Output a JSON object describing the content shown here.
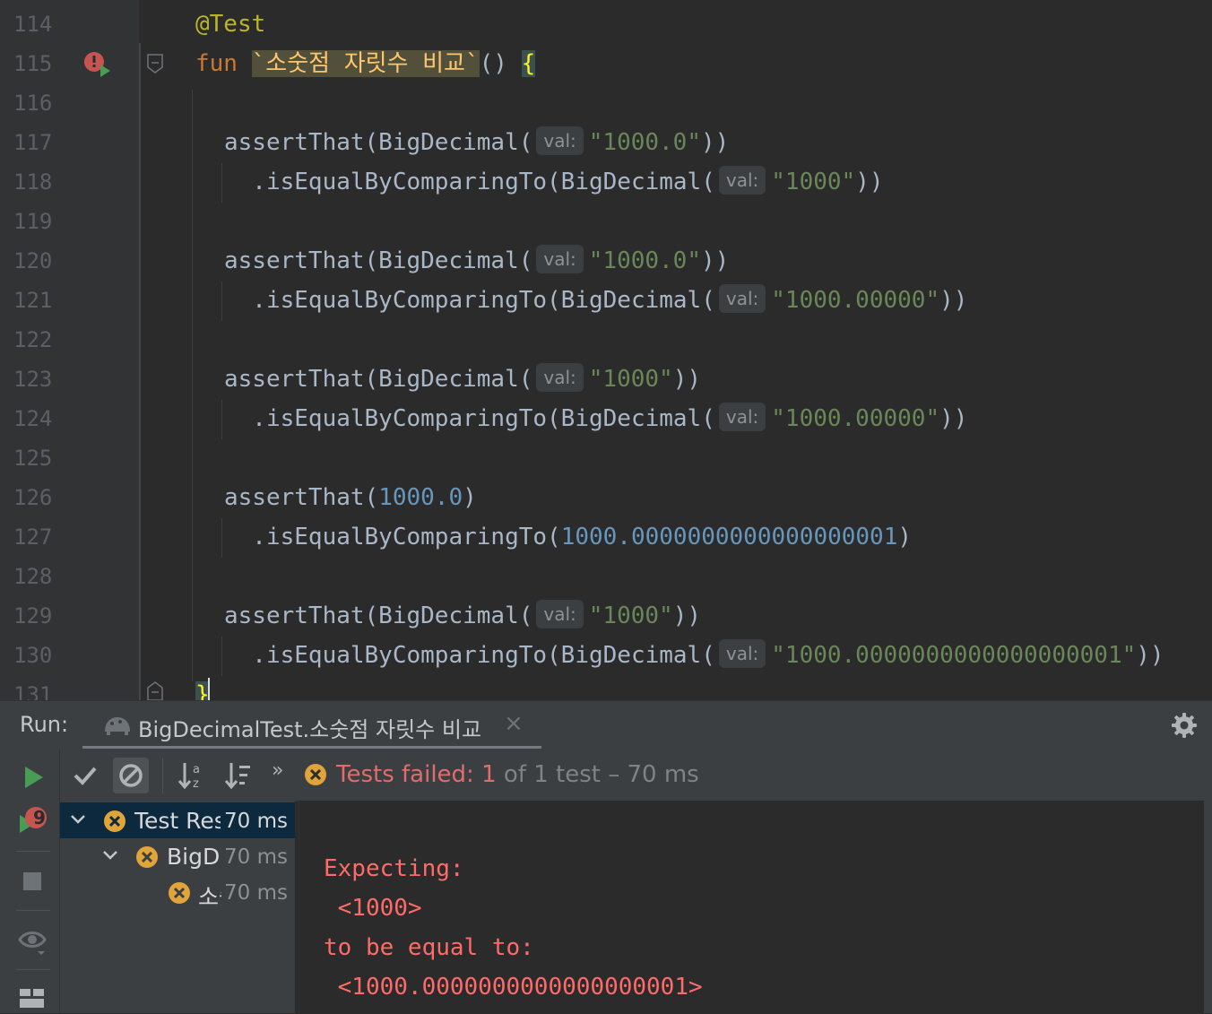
{
  "editor": {
    "line_numbers": [
      "114",
      "115",
      "116",
      "117",
      "118",
      "119",
      "120",
      "121",
      "122",
      "123",
      "124",
      "125",
      "126",
      "127",
      "128",
      "129",
      "130",
      "131"
    ],
    "hint_label": "val:",
    "lines": [
      {
        "n": "114",
        "tokens": [
          {
            "c": "ann",
            "t": "@Test"
          }
        ]
      },
      {
        "n": "115",
        "tokens": [
          {
            "c": "kw",
            "t": "fun"
          },
          {
            "c": "plain",
            "t": " "
          },
          {
            "c": "fname",
            "t": "`소숫점 자릿수 비교`"
          },
          {
            "c": "plain",
            "t": "() "
          },
          {
            "c": "brace-hl",
            "t": "{"
          }
        ]
      },
      {
        "n": "116",
        "tokens": []
      },
      {
        "n": "117",
        "tokens": [
          {
            "c": "plain",
            "t": "assertThat(BigDecimal("
          },
          {
            "c": "hint",
            "t": "val:"
          },
          {
            "c": "str",
            "t": "\"1000.0\""
          },
          {
            "c": "plain",
            "t": "))"
          }
        ]
      },
      {
        "n": "118",
        "tokens": [
          {
            "c": "plain",
            "t": "  .isEqualByComparingTo(BigDecimal("
          },
          {
            "c": "hint",
            "t": "val:"
          },
          {
            "c": "str",
            "t": "\"1000\""
          },
          {
            "c": "plain",
            "t": "))"
          }
        ]
      },
      {
        "n": "119",
        "tokens": []
      },
      {
        "n": "120",
        "tokens": [
          {
            "c": "plain",
            "t": "assertThat(BigDecimal("
          },
          {
            "c": "hint",
            "t": "val:"
          },
          {
            "c": "str",
            "t": "\"1000.0\""
          },
          {
            "c": "plain",
            "t": "))"
          }
        ]
      },
      {
        "n": "121",
        "tokens": [
          {
            "c": "plain",
            "t": "  .isEqualByComparingTo(BigDecimal("
          },
          {
            "c": "hint",
            "t": "val:"
          },
          {
            "c": "str",
            "t": "\"1000.00000\""
          },
          {
            "c": "plain",
            "t": "))"
          }
        ]
      },
      {
        "n": "122",
        "tokens": []
      },
      {
        "n": "123",
        "tokens": [
          {
            "c": "plain",
            "t": "assertThat(BigDecimal("
          },
          {
            "c": "hint",
            "t": "val:"
          },
          {
            "c": "str",
            "t": "\"1000\""
          },
          {
            "c": "plain",
            "t": "))"
          }
        ]
      },
      {
        "n": "124",
        "tokens": [
          {
            "c": "plain",
            "t": "  .isEqualByComparingTo(BigDecimal("
          },
          {
            "c": "hint",
            "t": "val:"
          },
          {
            "c": "str",
            "t": "\"1000.00000\""
          },
          {
            "c": "plain",
            "t": "))"
          }
        ]
      },
      {
        "n": "125",
        "tokens": []
      },
      {
        "n": "126",
        "tokens": [
          {
            "c": "plain",
            "t": "assertThat("
          },
          {
            "c": "num",
            "t": "1000.0"
          },
          {
            "c": "plain",
            "t": ")"
          }
        ]
      },
      {
        "n": "127",
        "tokens": [
          {
            "c": "plain",
            "t": "  .isEqualByComparingTo("
          },
          {
            "c": "num",
            "t": "1000.0000000000000000001"
          },
          {
            "c": "plain",
            "t": ")"
          }
        ]
      },
      {
        "n": "128",
        "tokens": []
      },
      {
        "n": "129",
        "tokens": [
          {
            "c": "plain",
            "t": "assertThat(BigDecimal("
          },
          {
            "c": "hint",
            "t": "val:"
          },
          {
            "c": "str",
            "t": "\"1000\""
          },
          {
            "c": "plain",
            "t": "))"
          }
        ]
      },
      {
        "n": "130",
        "tokens": [
          {
            "c": "plain",
            "t": "  .isEqualByComparingTo(BigDecimal("
          },
          {
            "c": "hint",
            "t": "val:"
          },
          {
            "c": "str",
            "t": "\"1000.0000000000000000001\""
          },
          {
            "c": "plain",
            "t": "))"
          }
        ]
      },
      {
        "n": "131",
        "tokens": [
          {
            "c": "brace-hl",
            "t": "}"
          }
        ]
      }
    ]
  },
  "run_panel": {
    "label": "Run:",
    "tab_title": "BigDecimalTest.소숫점 자릿수 비교",
    "status_failed": "Tests failed: 1",
    "status_rest": " of 1 test – 70 ms",
    "rerun_badge": "9",
    "tree": [
      {
        "label": "Test Results",
        "time": "70 ms",
        "level": 0,
        "selected": true,
        "expanded": true
      },
      {
        "label": "BigDecimalTest",
        "time": "70 ms",
        "level": 1,
        "selected": false,
        "expanded": true
      },
      {
        "label": "소숫점 자릿수 비교",
        "time": "70 ms",
        "level": 2,
        "selected": false,
        "expanded": false
      }
    ],
    "console_lines": [
      "Expecting:",
      " <1000>",
      "to be equal to:",
      " <1000.0000000000000000001>"
    ]
  },
  "colors": {
    "background": "#2b2b2b",
    "keyword": "#cc7832",
    "annotation": "#bbb529",
    "string": "#6a8759",
    "number": "#6897bb",
    "error": "#ff6b68",
    "test_fail_icon": "#e0a43a"
  },
  "icons": [
    "run-test-gutter-icon",
    "fold-icon",
    "run-config-icon",
    "close-icon",
    "gear-icon",
    "run-icon",
    "rerun-failed-icon",
    "stop-icon",
    "eye-icon",
    "layout-icon",
    "check-icon",
    "ignored-icon",
    "sort-alpha-icon",
    "sort-duration-icon",
    "more-icon",
    "test-failed-icon",
    "chevron-down-icon"
  ]
}
